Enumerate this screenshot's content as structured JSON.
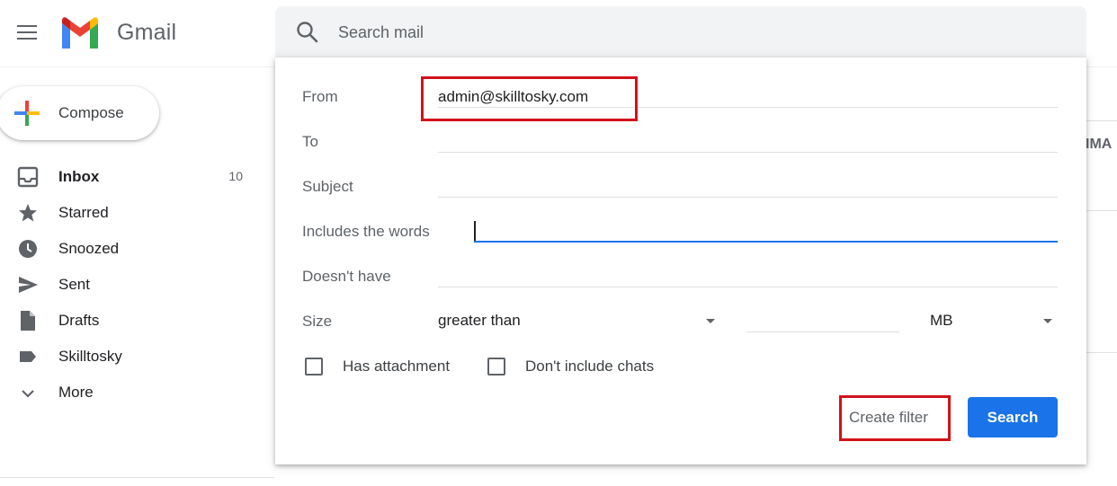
{
  "app": {
    "name": "Gmail"
  },
  "search": {
    "placeholder": "Search mail"
  },
  "compose": {
    "label": "Compose"
  },
  "sidebar": {
    "items": [
      {
        "label": "Inbox",
        "count": "10",
        "icon": "inbox-icon"
      },
      {
        "label": "Starred",
        "count": "",
        "icon": "star-icon"
      },
      {
        "label": "Snoozed",
        "count": "",
        "icon": "clock-icon"
      },
      {
        "label": "Sent",
        "count": "",
        "icon": "send-icon"
      },
      {
        "label": "Drafts",
        "count": "",
        "icon": "draft-icon"
      },
      {
        "label": "Skilltosky",
        "count": "",
        "icon": "label-icon"
      },
      {
        "label": "More",
        "count": "",
        "icon": "chevron-down-icon"
      }
    ]
  },
  "background": {
    "tab_fragment": "IMA"
  },
  "search_options": {
    "from": {
      "label": "From",
      "value": "admin@skilltosky.com"
    },
    "to": {
      "label": "To",
      "value": ""
    },
    "subject": {
      "label": "Subject",
      "value": ""
    },
    "includes": {
      "label": "Includes the words",
      "value": ""
    },
    "excludes": {
      "label": "Doesn't have",
      "value": ""
    },
    "size": {
      "label": "Size",
      "operator": "greater than",
      "value": "",
      "unit": "MB"
    },
    "has_attachment": {
      "label": "Has attachment",
      "checked": false
    },
    "no_chats": {
      "label": "Don't include chats",
      "checked": false
    },
    "create_filter_label": "Create filter",
    "search_label": "Search"
  },
  "colors": {
    "accent": "#1a73e8",
    "highlight": "#d0121b"
  }
}
